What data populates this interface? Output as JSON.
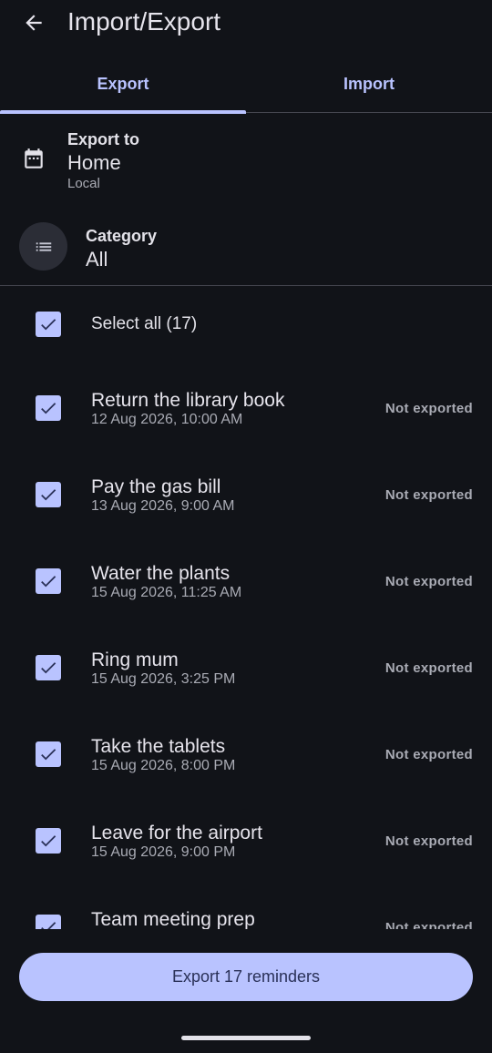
{
  "header": {
    "title": "Import/Export"
  },
  "tabs": [
    {
      "label": "Export",
      "active": true
    },
    {
      "label": "Import",
      "active": false
    }
  ],
  "export_to": {
    "label": "Export to",
    "value": "Home",
    "sub": "Local"
  },
  "category": {
    "label": "Category",
    "value": "All"
  },
  "select_all": {
    "label": "Select all (17)",
    "checked": true
  },
  "items": [
    {
      "title": "Return the library book",
      "date": "12 Aug 2026, 10:00 AM",
      "status": "Not exported",
      "checked": true
    },
    {
      "title": "Pay the gas bill",
      "date": "13 Aug 2026, 9:00 AM",
      "status": "Not exported",
      "checked": true
    },
    {
      "title": "Water the plants",
      "date": "15 Aug 2026, 11:25 AM",
      "status": "Not exported",
      "checked": true
    },
    {
      "title": "Ring mum",
      "date": "15 Aug 2026, 3:25 PM",
      "status": "Not exported",
      "checked": true
    },
    {
      "title": "Take the tablets",
      "date": "15 Aug 2026, 8:00 PM",
      "status": "Not exported",
      "checked": true
    },
    {
      "title": "Leave for the airport",
      "date": "15 Aug 2026, 9:00 PM",
      "status": "Not exported",
      "checked": true
    },
    {
      "title": "Team meeting prep",
      "date": "",
      "status": "Not exported",
      "checked": true
    }
  ],
  "export_button": {
    "label": "Export 17 reminders"
  },
  "colors": {
    "background": "#111318",
    "accent": "#b9c3ff",
    "on_accent": "#2a3158",
    "divider": "#45464f"
  },
  "icons": {
    "back": "arrow-back-icon",
    "calendar": "calendar-icon",
    "category": "list-icon",
    "check": "check-icon"
  }
}
